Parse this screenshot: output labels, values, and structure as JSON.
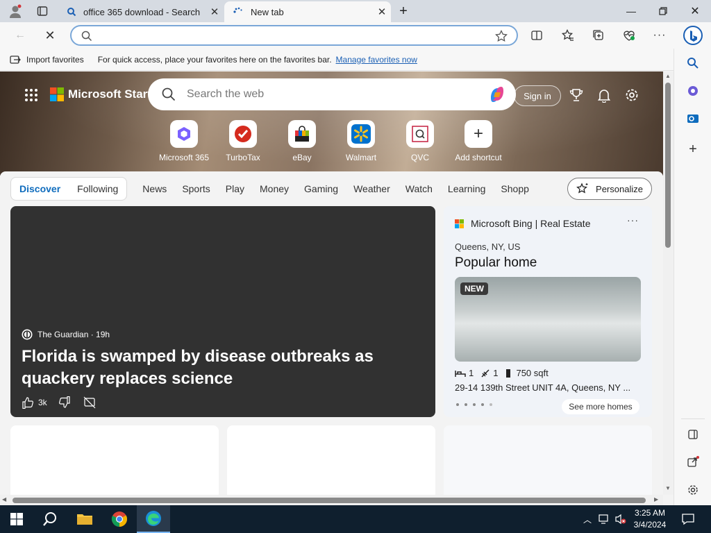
{
  "tabs": [
    {
      "title": "office 365 download - Search",
      "active": false
    },
    {
      "title": "New tab",
      "active": true
    }
  ],
  "favorites_bar": {
    "import_label": "Import favorites",
    "message": "For quick access, place your favorites here on the favorites bar.",
    "link": "Manage favorites now"
  },
  "header": {
    "logo": "Microsoft Start",
    "search_placeholder": "Search the web",
    "sign_in": "Sign in"
  },
  "shortcuts": [
    {
      "label": "Microsoft 365"
    },
    {
      "label": "TurboTax"
    },
    {
      "label": "eBay"
    },
    {
      "label": "Walmart"
    },
    {
      "label": "QVC"
    },
    {
      "label": "Add shortcut"
    }
  ],
  "nav": {
    "discover": "Discover",
    "following": "Following",
    "items": [
      "News",
      "Sports",
      "Play",
      "Money",
      "Gaming",
      "Weather",
      "Watch",
      "Learning",
      "Shopp"
    ],
    "personalize": "Personalize"
  },
  "main_story": {
    "source": "The Guardian · 19h",
    "headline": "Florida is swamped by disease outbreaks as quackery replaces science",
    "likes": "3k"
  },
  "real_estate": {
    "brand": "Microsoft Bing | Real Estate",
    "location": "Queens, NY, US",
    "heading": "Popular home",
    "badge": "NEW",
    "beds": "1",
    "baths": "1",
    "sqft": "750 sqft",
    "address": "29-14 139th Street UNIT 4A, Queens, NY ...",
    "see_more": "See more homes"
  },
  "taskbar": {
    "time": "3:25 AM",
    "date": "3/4/2024"
  },
  "colors": {
    "accent": "#0f6cbd",
    "taskbar": "#0f1f2e",
    "card_dark": "#313131"
  }
}
